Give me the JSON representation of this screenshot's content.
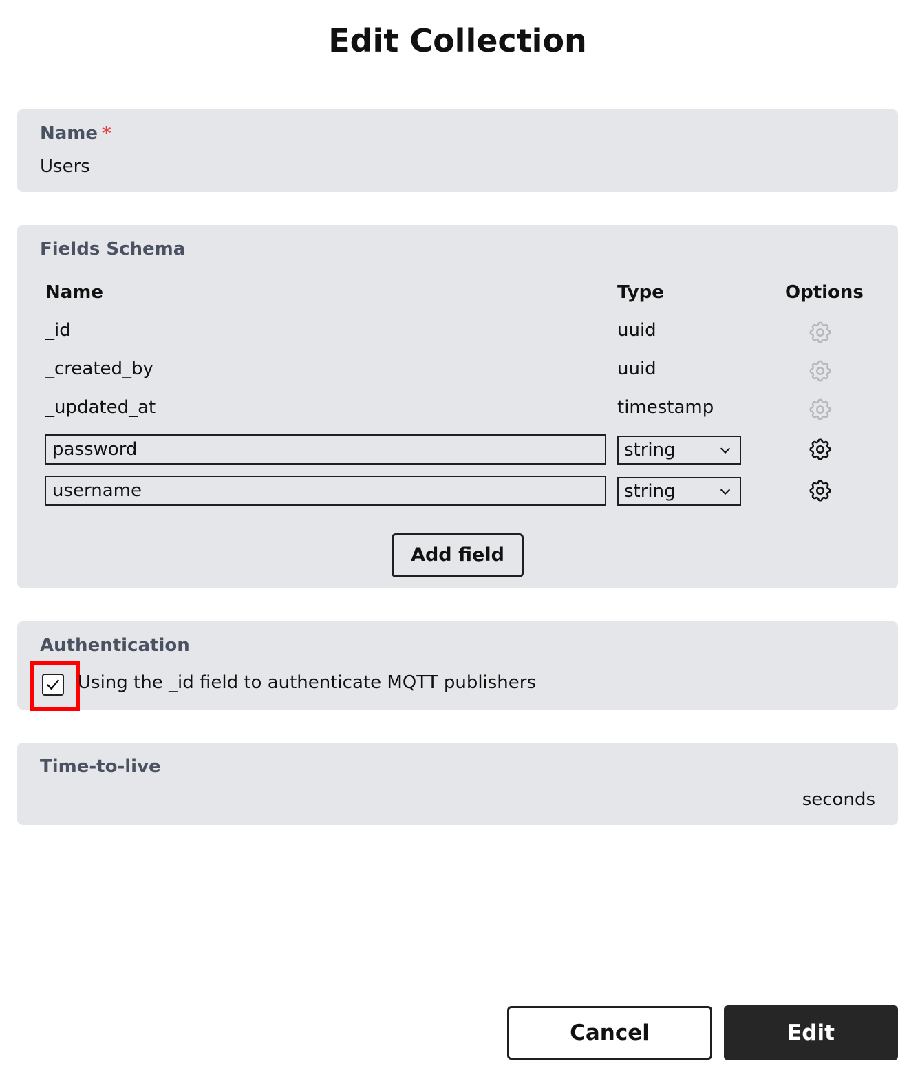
{
  "dialog": {
    "title": "Edit Collection"
  },
  "name_section": {
    "label": "Name",
    "required_mark": "*",
    "value": "Users"
  },
  "schema": {
    "label": "Fields Schema",
    "headers": {
      "name": "Name",
      "type": "Type",
      "options": "Options"
    },
    "system_fields": [
      {
        "name": "_id",
        "type": "uuid"
      },
      {
        "name": "_created_by",
        "type": "uuid"
      },
      {
        "name": "_updated_at",
        "type": "timestamp"
      }
    ],
    "custom_fields": [
      {
        "name": "password",
        "type": "string"
      },
      {
        "name": "username",
        "type": "string"
      }
    ],
    "add_field_label": "Add field"
  },
  "authentication": {
    "label": "Authentication",
    "checkbox_checked": true,
    "checkbox_label": "Using the _id field to authenticate MQTT publishers"
  },
  "ttl": {
    "label": "Time-to-live",
    "unit": "seconds"
  },
  "footer": {
    "cancel_label": "Cancel",
    "edit_label": "Edit"
  },
  "icons": {
    "options": "gear-icon",
    "select": "chevron-down-icon",
    "check": "checkmark-icon"
  },
  "colors": {
    "card_bg": "#e5e6ea",
    "required": "#e53e3e",
    "highlight": "#ff0000",
    "primary_button": "#262626"
  }
}
